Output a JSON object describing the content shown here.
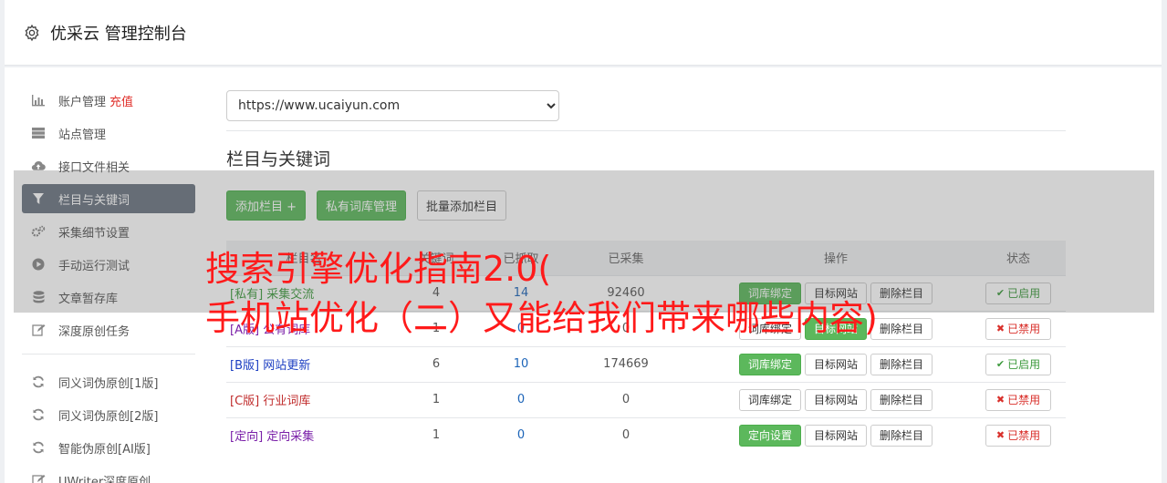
{
  "header": {
    "title": "优采云 管理控制台"
  },
  "sidebar": {
    "items": [
      {
        "label": "账户管理",
        "extra": "充值",
        "icon": "bar-chart-icon"
      },
      {
        "label": "站点管理",
        "icon": "server-icon"
      },
      {
        "label": "接口文件相关",
        "icon": "cloud-upload-icon"
      },
      {
        "label": "栏目与关键词",
        "icon": "filter-icon",
        "active": true
      },
      {
        "label": "采集细节设置",
        "icon": "gears-icon"
      },
      {
        "label": "手动运行测试",
        "icon": "play-circle-icon"
      },
      {
        "label": "文章暂存库",
        "icon": "database-icon"
      },
      {
        "label": "深度原创任务",
        "icon": "edit-icon"
      }
    ],
    "items2": [
      {
        "label": "同义词伪原创[1版]",
        "icon": "refresh-icon"
      },
      {
        "label": "同义词伪原创[2版]",
        "icon": "refresh-icon"
      },
      {
        "label": "智能伪原创[AI版]",
        "icon": "refresh-icon"
      },
      {
        "label": "UWriter深度原创",
        "icon": "edit-icon"
      }
    ]
  },
  "main": {
    "site_select": "https://www.ucaiyun.com",
    "section_title": "栏目与关键词",
    "buttons": {
      "add": "添加栏目 +",
      "private": "私有词库管理",
      "batch": "批量添加栏目"
    },
    "table": {
      "headers": [
        "栏目名",
        "关键词",
        "已抓取",
        "已采集",
        "操作",
        "状态"
      ],
      "rows": [
        {
          "name": "[私有] 采集交流",
          "kw": "4",
          "grab": "14",
          "coll": "92460",
          "op1": "词库绑定",
          "op2": "目标网站",
          "op3": "删除栏目",
          "status": "已启用"
        },
        {
          "name": "[A版] 公有词库",
          "kw": "1",
          "grab": "0",
          "coll": "0",
          "op1": "词库绑定",
          "op2": "目标网站",
          "op3": "删除栏目",
          "status": "已禁用"
        },
        {
          "name": "[B版] 网站更新",
          "kw": "6",
          "grab": "10",
          "coll": "174669",
          "op1": "词库绑定",
          "op2": "目标网站",
          "op3": "删除栏目",
          "status": "已启用"
        },
        {
          "name": "[C版] 行业词库",
          "kw": "1",
          "grab": "0",
          "coll": "0",
          "op1": "词库绑定",
          "op2": "目标网站",
          "op3": "删除栏目",
          "status": "已禁用"
        },
        {
          "name": "[定向] 定向采集",
          "kw": "1",
          "grab": "0",
          "coll": "0",
          "op1": "定向设置",
          "op2": "目标网站",
          "op3": "删除栏目",
          "status": "已禁用"
        }
      ]
    }
  },
  "overlay": {
    "line1": "搜索引擎优化指南2.0(",
    "line2": "手机站优化（二）又能给我们带来哪些内容)"
  }
}
